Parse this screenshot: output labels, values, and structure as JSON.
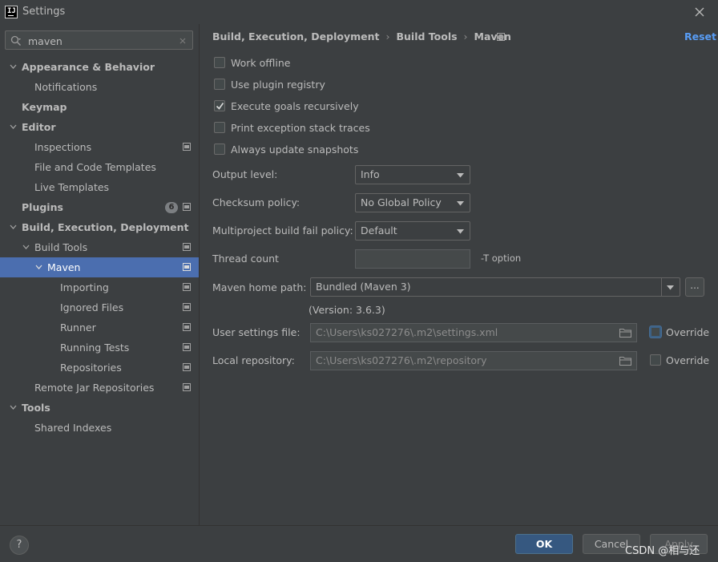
{
  "window": {
    "title": "Settings"
  },
  "search": {
    "value": "maven"
  },
  "sidebar": {
    "items": [
      {
        "label": "Appearance & Behavior"
      },
      {
        "label": "Notifications"
      },
      {
        "label": "Keymap"
      },
      {
        "label": "Editor"
      },
      {
        "label": "Inspections"
      },
      {
        "label": "File and Code Templates"
      },
      {
        "label": "Live Templates"
      },
      {
        "label": "Plugins",
        "badge": "6"
      },
      {
        "label": "Build, Execution, Deployment"
      },
      {
        "label": "Build Tools"
      },
      {
        "label": "Maven"
      },
      {
        "label": "Importing"
      },
      {
        "label": "Ignored Files"
      },
      {
        "label": "Runner"
      },
      {
        "label": "Running Tests"
      },
      {
        "label": "Repositories"
      },
      {
        "label": "Remote Jar Repositories"
      },
      {
        "label": "Tools"
      },
      {
        "label": "Shared Indexes"
      }
    ]
  },
  "breadcrumb": [
    "Build, Execution, Deployment",
    "Build Tools",
    "Maven"
  ],
  "reset_label": "Reset",
  "checkboxes": [
    {
      "label": "Work offline",
      "checked": false
    },
    {
      "label": "Use plugin registry",
      "checked": false
    },
    {
      "label": "Execute goals recursively",
      "checked": true
    },
    {
      "label": "Print exception stack traces",
      "checked": false
    },
    {
      "label": "Always update snapshots",
      "checked": false
    }
  ],
  "form": {
    "output_level": {
      "label": "Output level:",
      "value": "Info"
    },
    "checksum_policy": {
      "label": "Checksum policy:",
      "value": "No Global Policy"
    },
    "fail_policy": {
      "label": "Multiproject build fail policy:",
      "value": "Default"
    },
    "thread_count": {
      "label": "Thread count",
      "value": "",
      "hint": "-T option"
    },
    "maven_home": {
      "label": "Maven home path:",
      "value": "Bundled (Maven 3)",
      "browse": "...",
      "version": "(Version: 3.6.3)"
    },
    "user_settings": {
      "label": "User settings file:",
      "value": "C:\\Users\\ks027276\\.m2\\settings.xml",
      "override": "Override"
    },
    "local_repo": {
      "label": "Local repository:",
      "value": "C:\\Users\\ks027276\\.m2\\repository",
      "override": "Override"
    }
  },
  "buttons": {
    "help": "?",
    "ok": "OK",
    "cancel": "Cancel",
    "apply": "Apply"
  },
  "watermark": "CSDN @相与还"
}
